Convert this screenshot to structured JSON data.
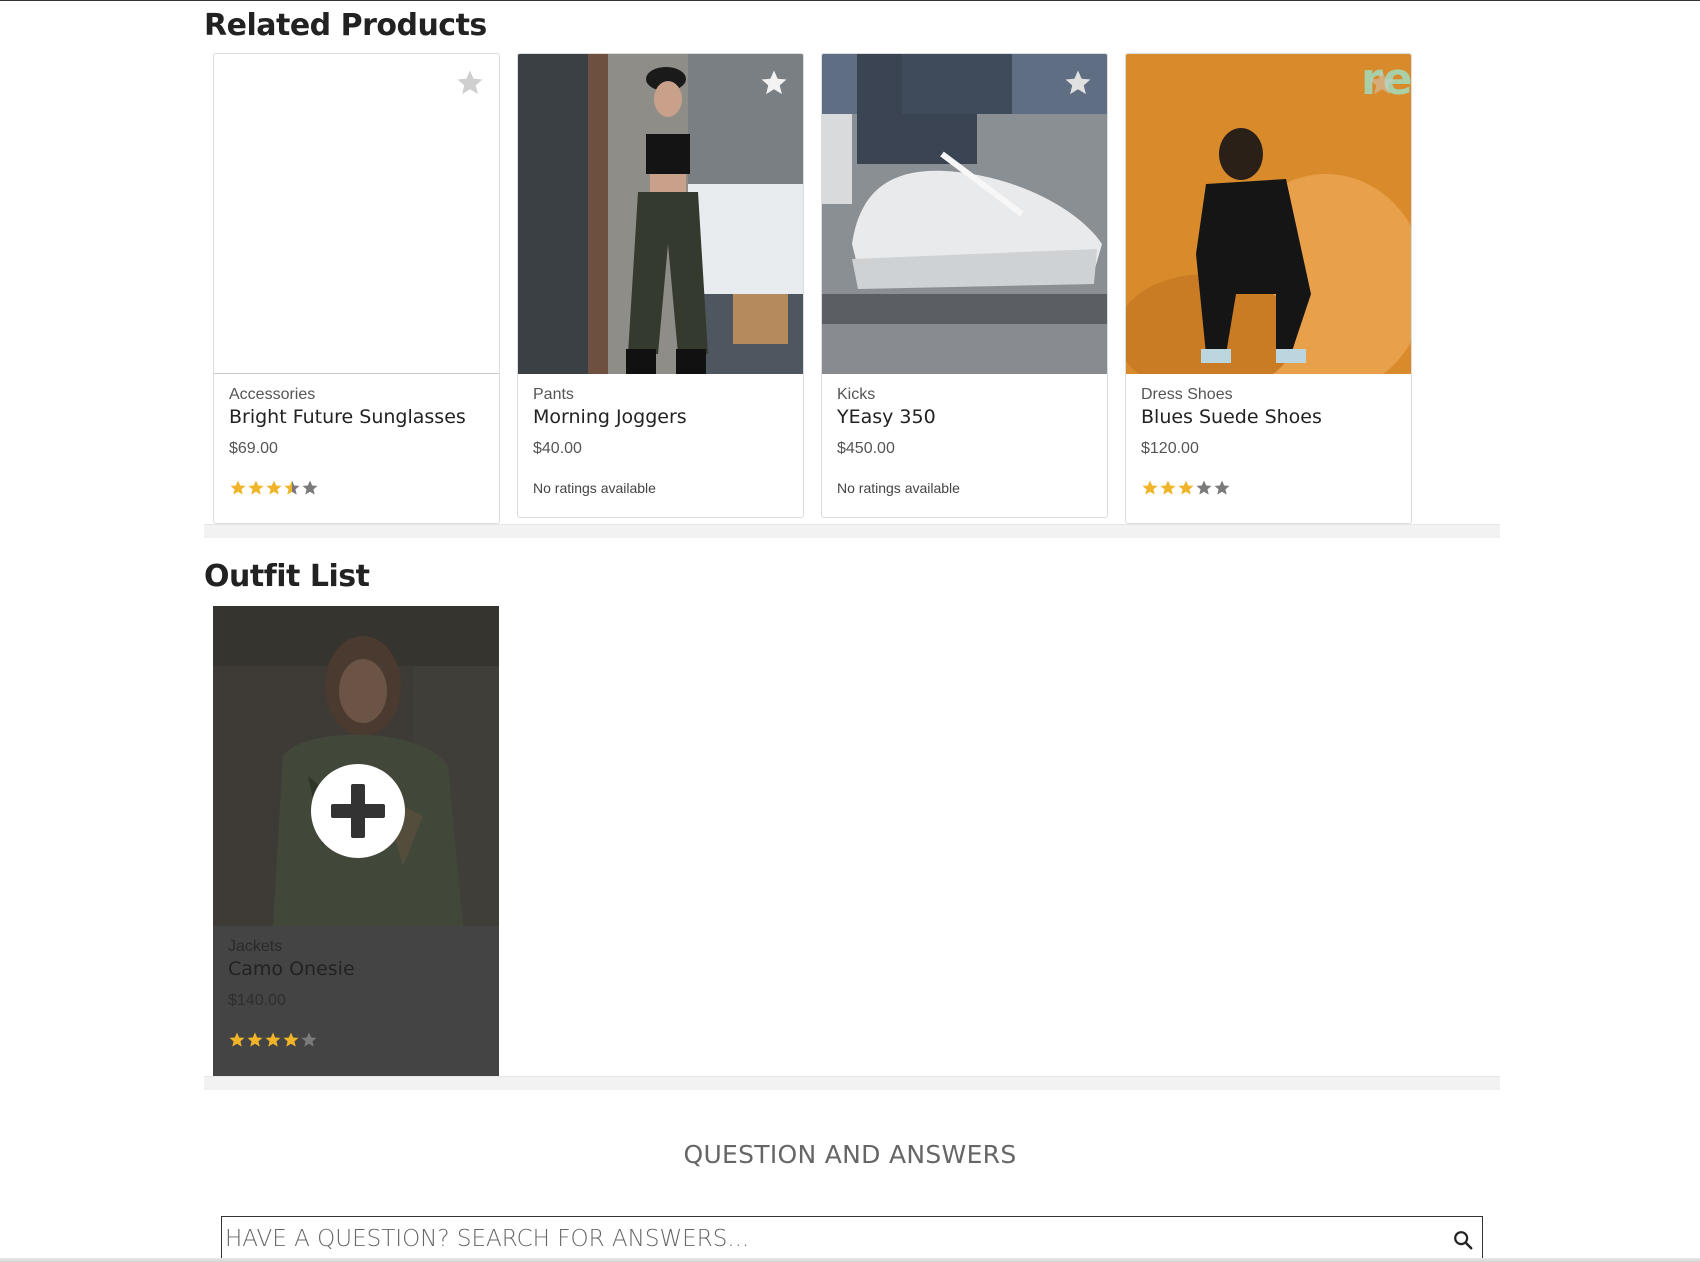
{
  "related": {
    "title": "Related Products",
    "products": [
      {
        "category": "Accessories",
        "name": "Bright Future Sunglasses",
        "price": "$69.00",
        "rating": 3.5,
        "rating_text": "",
        "image": "none"
      },
      {
        "category": "Pants",
        "name": "Morning Joggers",
        "price": "$40.00",
        "rating": null,
        "rating_text": "No ratings available",
        "image": "woman-in-cargo-joggers"
      },
      {
        "category": "Kicks",
        "name": "YEasy 350",
        "price": "$450.00",
        "rating": null,
        "rating_text": "No ratings available",
        "image": "white-sneaker-closeup"
      },
      {
        "category": "Dress Shoes",
        "name": "Blues Suede Shoes",
        "price": "$120.00",
        "rating": 3,
        "rating_text": "",
        "image": "man-on-orange-fur-chair"
      }
    ]
  },
  "outfit": {
    "title": "Outfit List",
    "items": [
      {
        "category": "Jackets",
        "name": "Camo Onesie",
        "price": "$140.00",
        "rating": 4,
        "image": "woman-in-camo-jacket"
      }
    ],
    "add_icon": "plus-circle-icon"
  },
  "qa": {
    "title": "QUESTION AND ANSWERS",
    "search_placeholder": "HAVE A QUESTION? SEARCH FOR ANSWERS...",
    "search_icon": "search-icon"
  },
  "colors": {
    "star_filled": "#f0b429",
    "star_empty": "#7a7a7a",
    "favorite_star": "#cfcfcf",
    "outfit_overlay": "#444444"
  }
}
